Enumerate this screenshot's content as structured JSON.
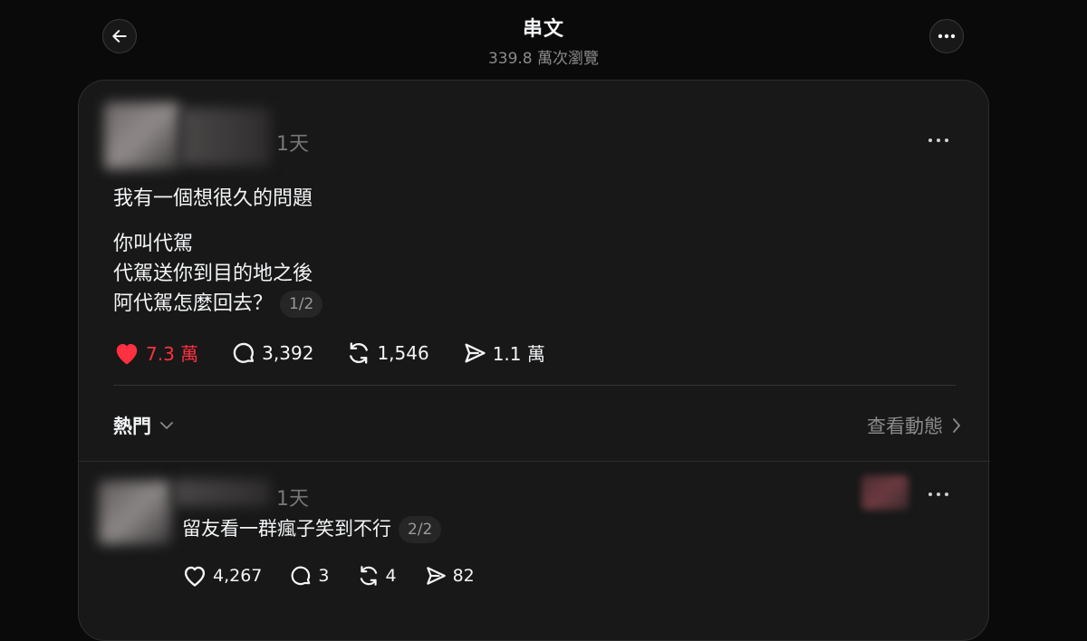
{
  "header": {
    "title": "串文",
    "views": "339.8 萬次瀏覽"
  },
  "icons": {
    "back": "arrow-left-icon",
    "more": "more-horizontal-icon",
    "like": "heart-icon",
    "comment": "comment-icon",
    "repost": "repost-icon",
    "share": "send-icon"
  },
  "post": {
    "time": "1天",
    "line1": "我有一個想很久的問題",
    "line2": "你叫代駕",
    "line3": "代駕送你到目的地之後",
    "line4": "阿代駕怎麼回去？",
    "pager": "1/2",
    "likes": "7.3 萬",
    "comments": "3,392",
    "reposts": "1,546",
    "shares": "1.1 萬",
    "liked": true
  },
  "sort": {
    "label": "熱門",
    "activity": "查看動態"
  },
  "reply": {
    "time": "1天",
    "text": "留友看一群瘋子笑到不行",
    "pager": "2/2",
    "likes": "4,267",
    "comments": "3",
    "reposts": "4",
    "shares": "82"
  },
  "colors": {
    "background": "#0a0a0a",
    "card": "#181818",
    "like_red": "#ff3040",
    "muted": "#8a8a8a"
  }
}
